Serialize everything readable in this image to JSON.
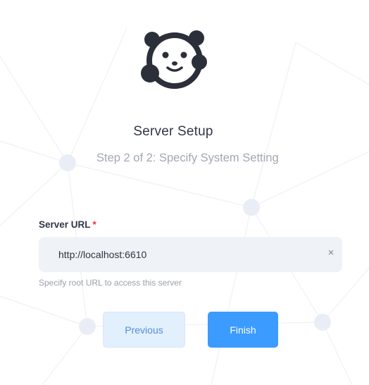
{
  "header": {
    "title": "Server Setup",
    "subtitle": "Step 2 of 2: Specify System Setting"
  },
  "form": {
    "server_url": {
      "label": "Server URL",
      "required_mark": "*",
      "value": "http://localhost:6610",
      "clear_symbol": "×",
      "hint": "Specify root URL to access this server"
    }
  },
  "actions": {
    "previous_label": "Previous",
    "finish_label": "Finish"
  },
  "colors": {
    "primary": "#3b9bff",
    "secondary_bg": "#e2effd",
    "required": "#e03a3a"
  },
  "icons": {
    "logo": "panda-logo-icon",
    "clear": "close-icon"
  }
}
